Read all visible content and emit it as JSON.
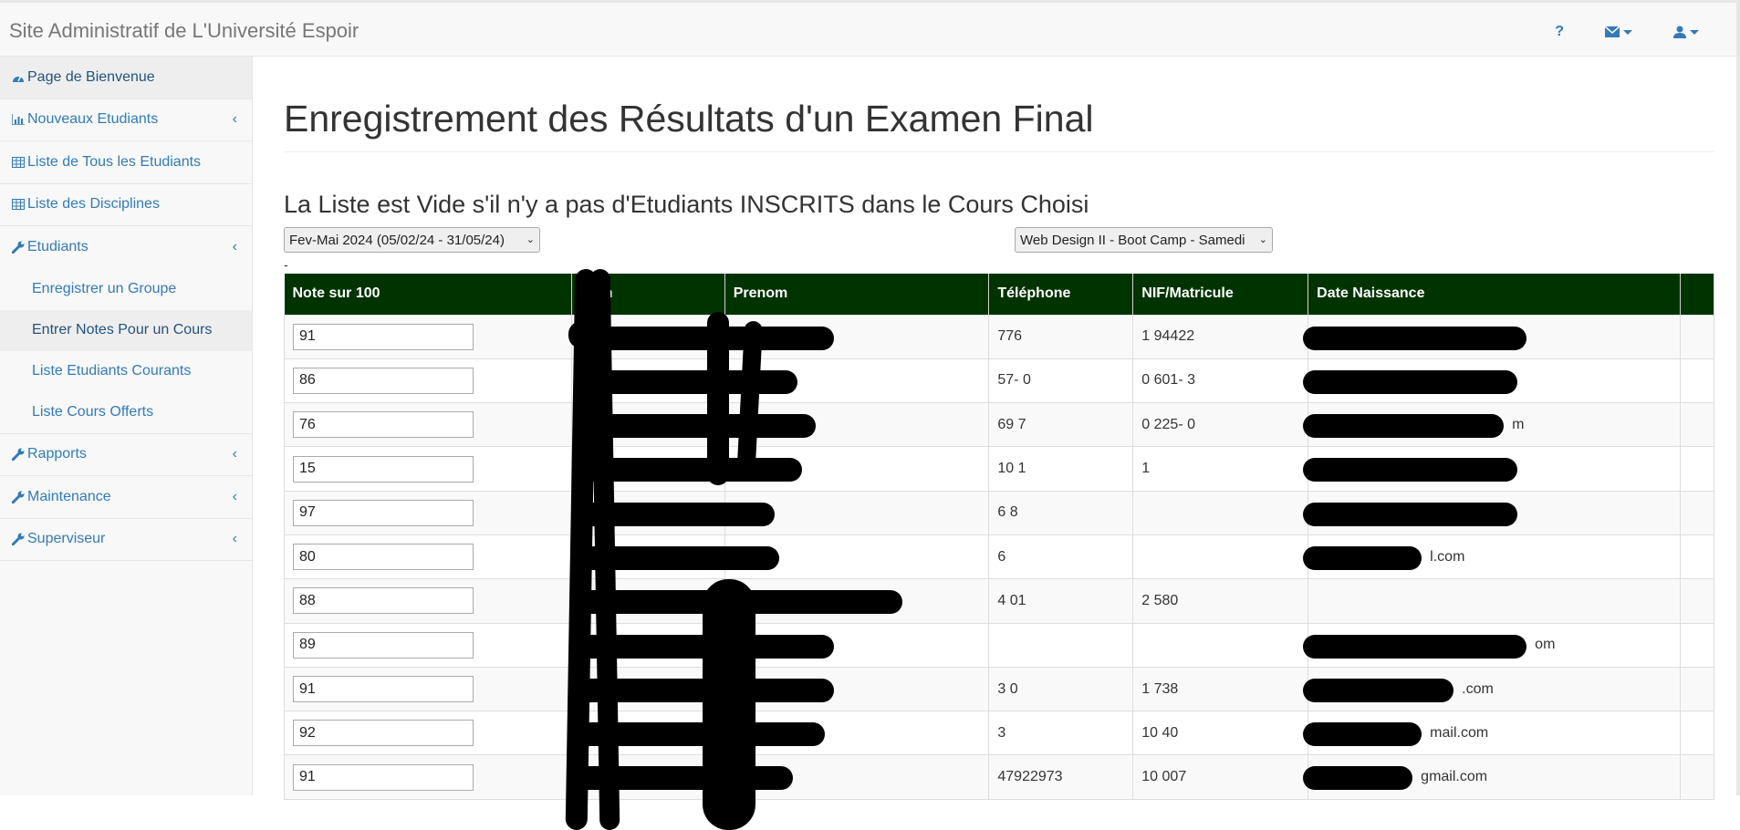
{
  "app": {
    "title": "Site Administratif de L'Université Espoir"
  },
  "topnav": {
    "help": "?",
    "mail_icon": "envelope-icon",
    "user_icon": "user-icon"
  },
  "sidebar": {
    "items": [
      {
        "label": "Page de Bienvenue",
        "icon": "dashboard-icon",
        "active": true
      },
      {
        "label": "Nouveaux Etudiants",
        "icon": "bar-chart-icon",
        "has_chevron": true
      },
      {
        "label": "Liste de Tous les Etudiants",
        "icon": "table-icon"
      },
      {
        "label": "Liste des Disciplines",
        "icon": "table-icon"
      },
      {
        "label": "Etudiants",
        "icon": "wrench-icon",
        "has_chevron": true
      },
      {
        "label": "Rapports",
        "icon": "wrench-icon",
        "has_chevron": true
      },
      {
        "label": "Maintenance",
        "icon": "wrench-icon",
        "has_chevron": true
      },
      {
        "label": "Superviseur",
        "icon": "wrench-icon",
        "has_chevron": true
      }
    ],
    "sub_items": [
      {
        "label": "Enregistrer un Groupe"
      },
      {
        "label": "Entrer Notes Pour un Cours",
        "active": true
      },
      {
        "label": "Liste Etudiants Courants"
      },
      {
        "label": "Liste Cours Offerts"
      }
    ]
  },
  "main": {
    "title": "Enregistrement des Résultats d'un Examen Final",
    "subtitle": "La Liste est Vide s'il n'y a pas d'Etudiants INSCRITS dans le Cours Choisi",
    "session_select": "Fev-Mai 2024 (05/02/24 - 31/05/24)",
    "course_select": "Web Design II - Boot Camp - Samedi",
    "dash": "-"
  },
  "table": {
    "headers": [
      "Note sur 100",
      "Nom",
      "Prenom",
      "Téléphone",
      "NIF/Matricule",
      "Date Naissance"
    ],
    "rows": [
      {
        "note": "91",
        "nom": "",
        "prenom": "",
        "tel": "776",
        "nif": "1 94422",
        "date": ""
      },
      {
        "note": "86",
        "nom": "",
        "prenom": "",
        "tel": "57- 0",
        "nif": "0 601- 3",
        "date": ""
      },
      {
        "note": "76",
        "nom": "",
        "prenom": "e",
        "tel": "69 7",
        "nif": "0 225- 0",
        "date": "m"
      },
      {
        "note": "15",
        "nom": "",
        "prenom": "y",
        "tel": "10 1",
        "nif": "1 ",
        "date": ""
      },
      {
        "note": "97",
        "nom": "",
        "prenom": "on",
        "tel": "6 8",
        "nif": "",
        "date": ""
      },
      {
        "note": "80",
        "nom": "",
        "prenom": "",
        "tel": "6",
        "nif": "",
        "date": "l.com"
      },
      {
        "note": "88",
        "nom": "",
        "prenom": "",
        "tel": "4 01",
        "nif": "2 580",
        "date": ""
      },
      {
        "note": "89",
        "nom": "",
        "prenom": "el",
        "tel": "",
        "nif": "",
        "date": "om"
      },
      {
        "note": "91",
        "nom": "",
        "prenom": "",
        "tel": "3 0",
        "nif": "1 738",
        "date": ".com"
      },
      {
        "note": "92",
        "nom": "",
        "prenom": "",
        "tel": "3",
        "nif": "10 40",
        "date": "mail.com"
      },
      {
        "note": "91",
        "nom": "Louis",
        "prenom": "y",
        "tel": "47922973",
        "nif": "10 007",
        "date": "gmail.com"
      }
    ]
  }
}
